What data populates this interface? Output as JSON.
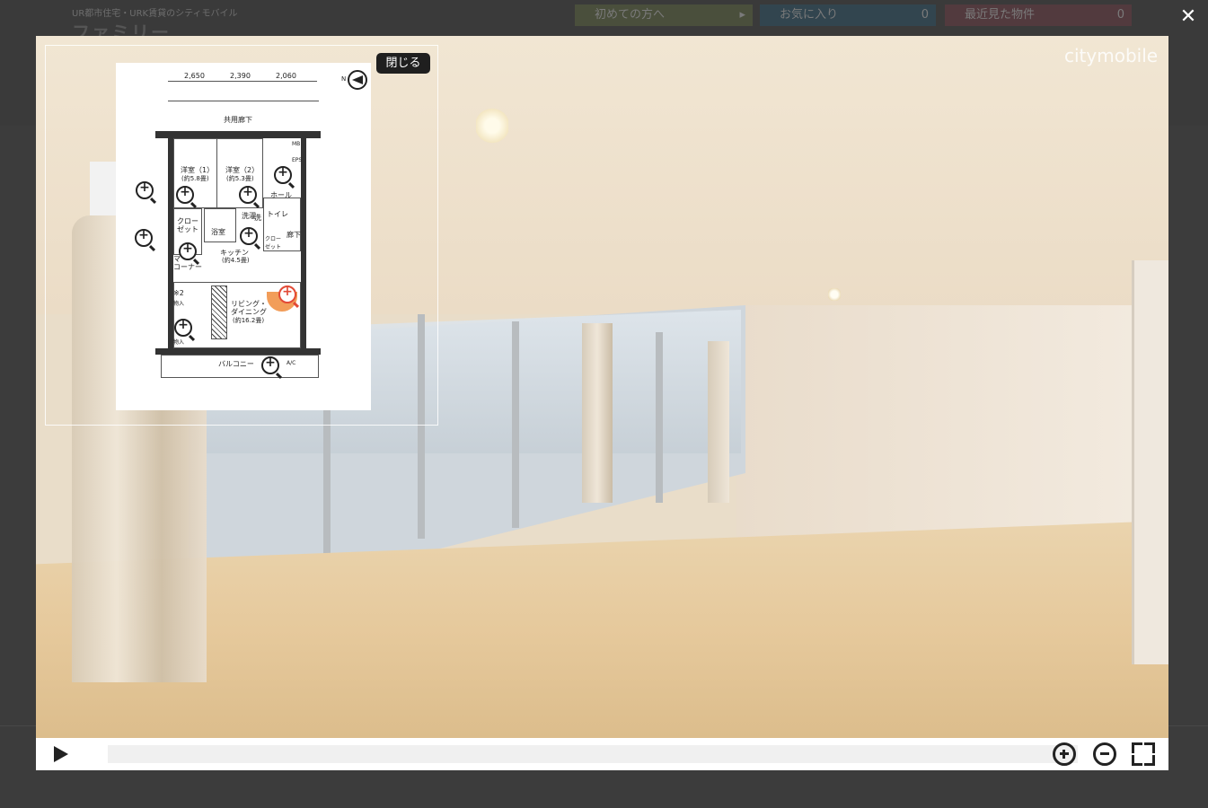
{
  "site": {
    "tagline": "UR都市住宅・URK賃貸のシティモバイル",
    "logo": "ファミリー",
    "buttons": [
      {
        "label": "初めての方へ",
        "count": ""
      },
      {
        "label": "お気に入り",
        "count": "0"
      },
      {
        "label": "最近見た物件",
        "count": "0"
      }
    ]
  },
  "viewer": {
    "watermark": "citymobile",
    "close_map_label": "閉じる",
    "close_icon": "close-icon"
  },
  "floorplan": {
    "dimensions": [
      "2,650",
      "2,390",
      "2,060"
    ],
    "north": "N",
    "rooms": {
      "common_corridor": "共用廊下",
      "western1": "洋室（1）",
      "western1_size": "(約5.8畳)",
      "western2": "洋室（2）",
      "western2_size": "(約5.3畳)",
      "hall": "ホール",
      "mb": "MB",
      "eps": "EPS",
      "closet": "クロー\nゼット",
      "bath": "浴室",
      "wash": "洗",
      "laundry": "洗濯",
      "toilet": "トイレ",
      "corridor": "廊下",
      "closet2": "クロー\nゼット",
      "kitchen": "キッチン",
      "kitchen_size": "(約4.5畳)",
      "corner": "マ\nコーナー",
      "living": "リビング・\nダイニング",
      "living_size": "(約16.2畳)",
      "note": "※2",
      "storage1": "物入",
      "storage2": "物入",
      "balcony": "バルコニー",
      "ac": "A/C"
    }
  },
  "controls": {
    "play_icon": "play-icon",
    "zoom_in_icon": "zoom-in-icon",
    "zoom_out_icon": "zoom-out-icon",
    "fullscreen_icon": "fullscreen-icon"
  }
}
